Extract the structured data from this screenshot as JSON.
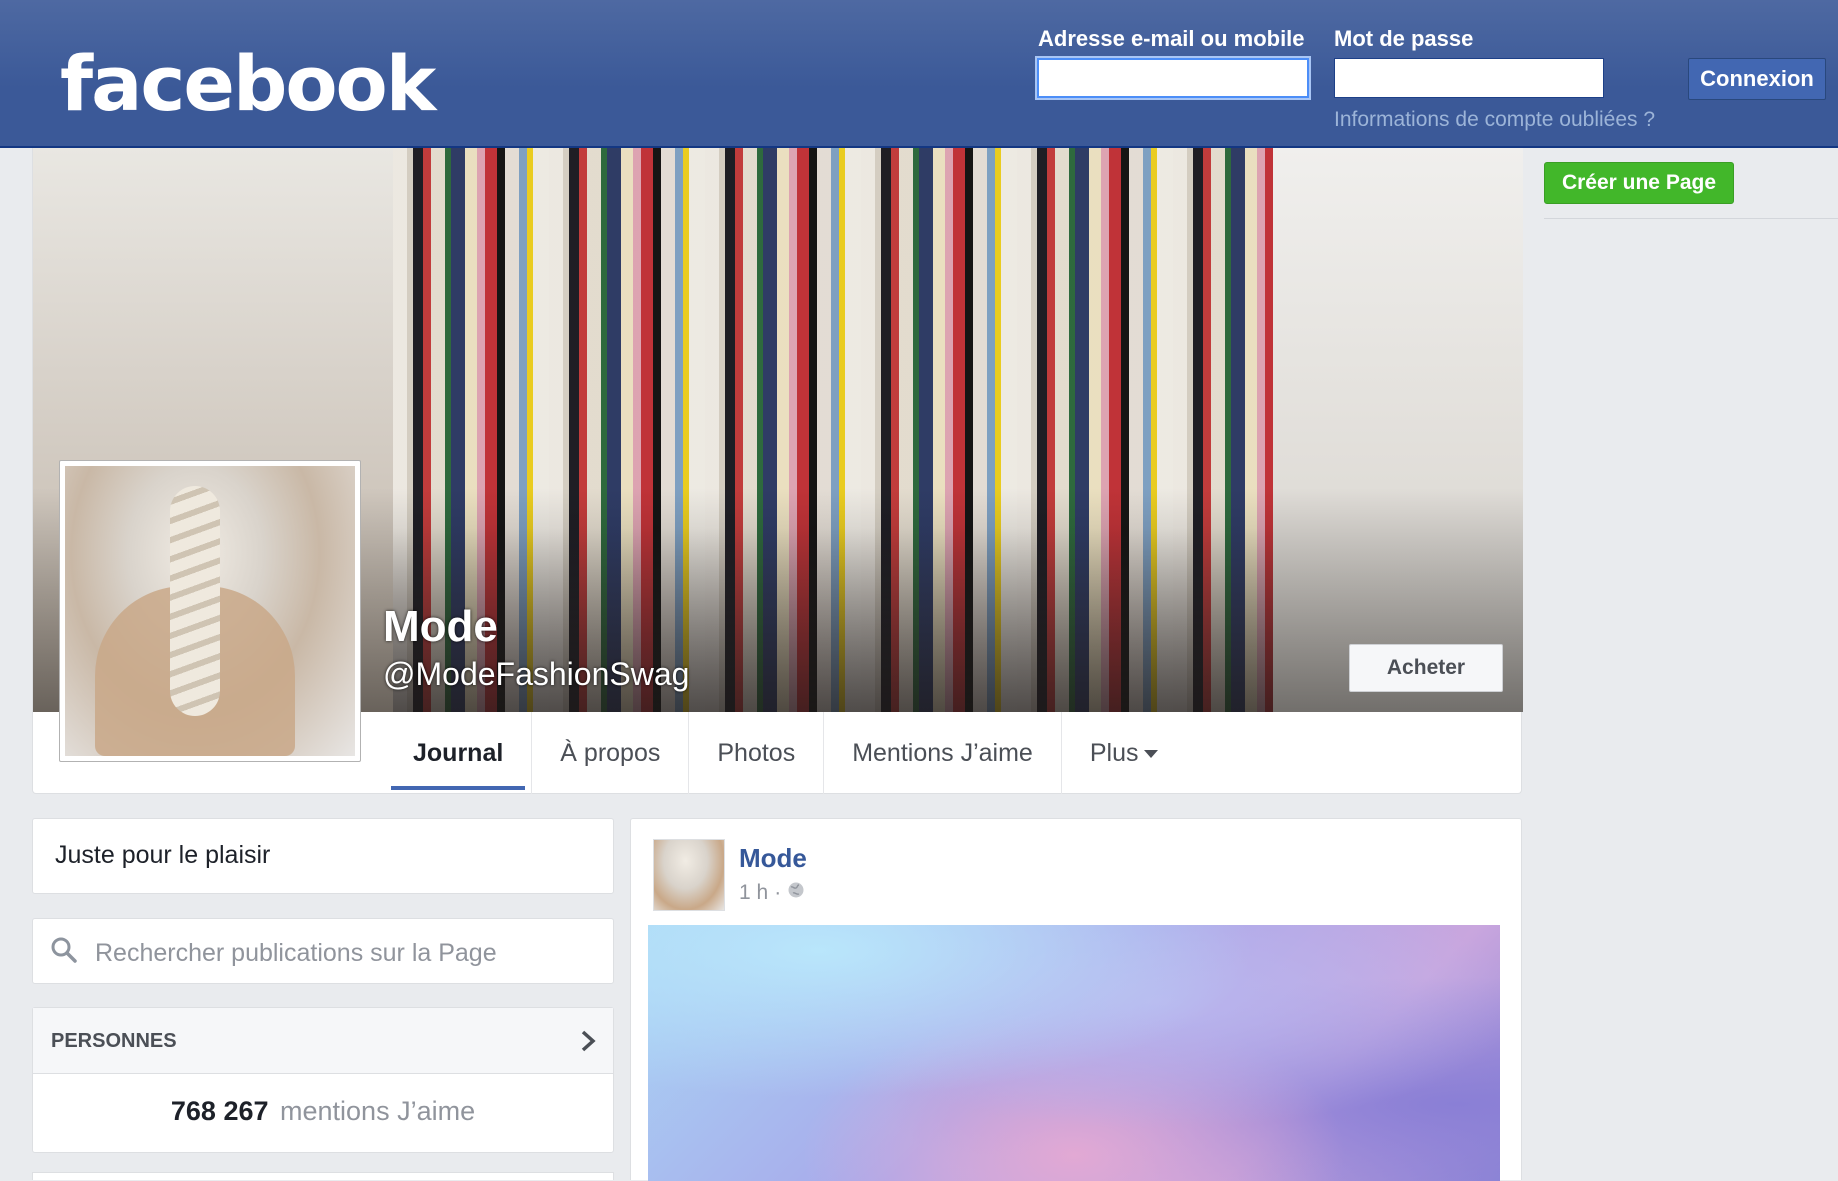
{
  "header": {
    "logo": "facebook",
    "email_label": "Adresse e-mail ou mobile",
    "email_value": "",
    "password_label": "Mot de passe",
    "password_value": "",
    "login_button": "Connexion",
    "forgot_link": "Informations de compte oubliées ?"
  },
  "sidebar_right": {
    "create_page_button": "Créer une Page"
  },
  "page": {
    "name": "Mode",
    "handle": "@ModeFashionSwag",
    "shop_button": "Acheter",
    "tabs": [
      {
        "label": "Journal",
        "active": true
      },
      {
        "label": "À propos",
        "active": false
      },
      {
        "label": "Photos",
        "active": false
      },
      {
        "label": "Mentions J’aime",
        "active": false
      },
      {
        "label": "Plus",
        "active": false
      }
    ]
  },
  "left": {
    "category": "Juste pour le plaisir",
    "search_placeholder": "Rechercher publications sur la Page",
    "people_title": "PERSONNES",
    "likes_count": "768 267",
    "likes_label": "mentions J’aime"
  },
  "post": {
    "author": "Mode",
    "time": "1 h",
    "separator": "·",
    "privacy_icon": "globe-icon"
  },
  "colors": {
    "header_blue": "#3b5998",
    "link_blue": "#365899",
    "create_green": "#42b72a",
    "tab_underline": "#4267b2"
  }
}
